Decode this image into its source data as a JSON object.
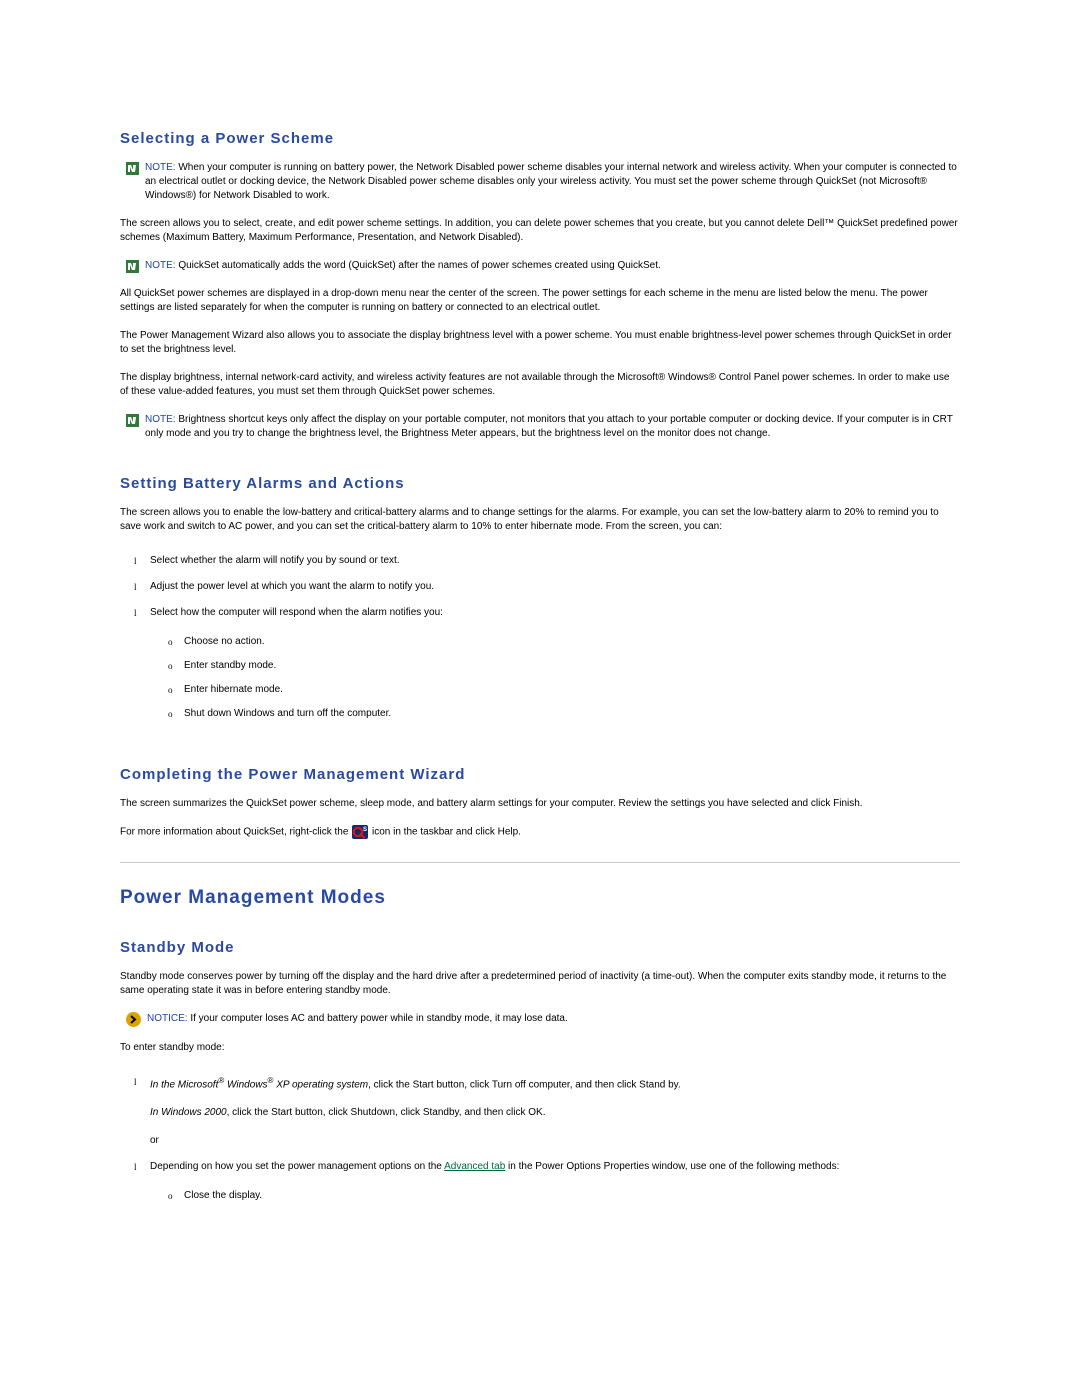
{
  "sec1": {
    "title": "Selecting a Power Scheme",
    "note1_label": "NOTE:",
    "note1_text": " When your computer is running on battery power, the Network Disabled power scheme disables your internal network and wireless activity. When your computer is connected to an electrical outlet or docking device, the Network Disabled power scheme disables only your wireless activity. You must set the power scheme through QuickSet (not Microsoft® Windows®) for Network Disabled to work.",
    "p1": "The screen allows you to select, create, and edit power scheme settings. In addition, you can delete power schemes that you create, but you cannot delete Dell™ QuickSet predefined power schemes (Maximum Battery, Maximum Performance, Presentation, and Network Disabled).",
    "note2_label": "NOTE:",
    "note2_text": " QuickSet automatically adds the word (QuickSet) after the names of power schemes created using QuickSet.",
    "p2": "All QuickSet power schemes are displayed in a drop-down menu near the center of the screen. The power settings for each scheme in the menu are listed below the menu. The power settings are listed separately for when the computer is running on battery or connected to an electrical outlet.",
    "p3": "The Power Management Wizard also allows you to associate the display brightness level with a power scheme. You must enable brightness-level power schemes through QuickSet in order to set the brightness level.",
    "p4": "The display brightness, internal network-card activity, and wireless activity features are not available through the Microsoft® Windows® Control Panel power schemes. In order to make use of these value-added features, you must set them through QuickSet power schemes.",
    "note3_label": "NOTE:",
    "note3_text": " Brightness shortcut keys only affect the display on your portable computer, not monitors that you attach to your portable computer or docking device. If your computer is in CRT only mode and you try to change the brightness level, the Brightness Meter appears, but the brightness level on the monitor does not change."
  },
  "sec2": {
    "title": "Setting Battery Alarms and Actions",
    "p1": "The screen allows you to enable the low-battery and critical-battery alarms and to change settings for the alarms. For example, you can set the low-battery alarm to 20% to remind you to save work and switch to AC power, and you can set the critical-battery alarm to 10% to enter hibernate mode. From the screen, you can:",
    "li1": "Select whether the alarm will notify you by sound or text.",
    "li2": "Adjust the power level at which you want the alarm to notify you.",
    "li3": "Select how the computer will respond when the alarm notifies you:",
    "sub1": "Choose no action.",
    "sub2": "Enter standby mode.",
    "sub3": "Enter hibernate mode.",
    "sub4": "Shut down Windows and turn off the computer."
  },
  "sec3": {
    "title": "Completing the Power Management Wizard",
    "p1": "The screen summarizes the QuickSet power scheme, sleep mode, and battery alarm settings for your computer. Review the settings you have selected and click Finish.",
    "p2a": "For more information about QuickSet, right-click the ",
    "p2b": " icon in the taskbar and click Help."
  },
  "major": {
    "title": "Power Management Modes"
  },
  "sec4": {
    "title": "Standby Mode",
    "p1": "Standby mode conserves power by turning off the display and the hard drive after a predetermined period of inactivity (a time-out). When the computer exits standby mode, it returns to the same operating state it was in before entering standby mode.",
    "notice_label": "NOTICE:",
    "notice_text": " If your computer loses AC and battery power while in standby mode, it may lose data.",
    "p2": "To enter standby mode:",
    "li1a": "In the Microsoft",
    "li1b": " Windows",
    "li1c": " XP operating system",
    "li1d": ", click the Start button, click Turn off computer, and then click Stand by.",
    "li1_line2a": "In Windows 2000",
    "li1_line2b": ", click the Start button, click Shutdown, click Standby, and then click OK.",
    "li1_or": "or",
    "li2a": "Depending on how you set the power management options on the ",
    "li2_link": "Advanced tab",
    "li2b": " in the Power Options Properties window, use one of the following methods:",
    "li2_sub1": "Close the display."
  }
}
